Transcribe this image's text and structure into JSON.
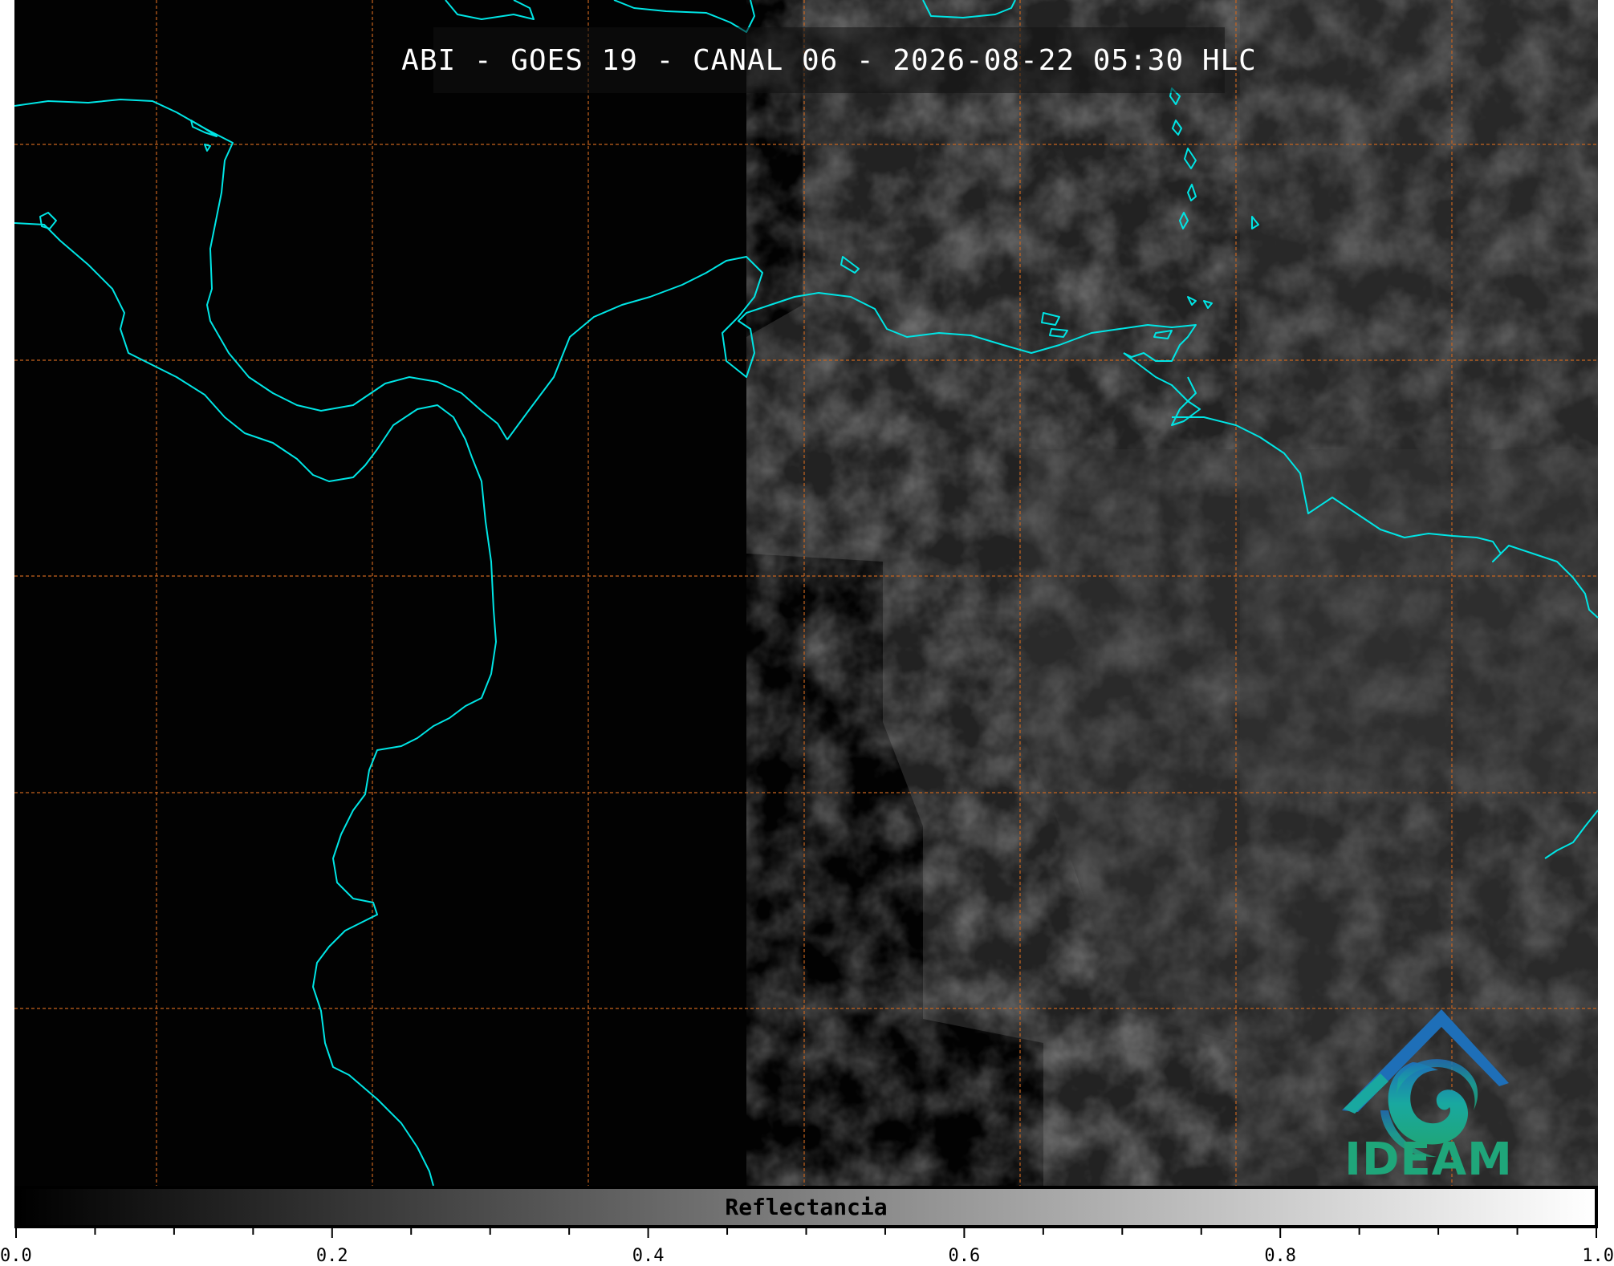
{
  "title": "ABI - GOES 19 - CANAL 06 - 2026-08-22 05:30 HLC",
  "colors": {
    "coastline": "#00e5e5",
    "gridline": "#c8641e",
    "background": "#020202",
    "logo_blue": "#1e6fb8",
    "logo_teal": "#19a8a0",
    "logo_green": "#1fa67a"
  },
  "colorbar": {
    "label": "Reflectancia",
    "range": [
      0.0,
      1.0
    ],
    "tick_labels": [
      "0.0",
      "0.2",
      "0.4",
      "0.6",
      "0.8",
      "1.0"
    ],
    "colormap": "gray"
  },
  "map": {
    "gridlines": "dashed",
    "coastlines": true
  },
  "logo": {
    "text": "IDEAM",
    "icon": "ideam-mountain-swirl-icon"
  }
}
